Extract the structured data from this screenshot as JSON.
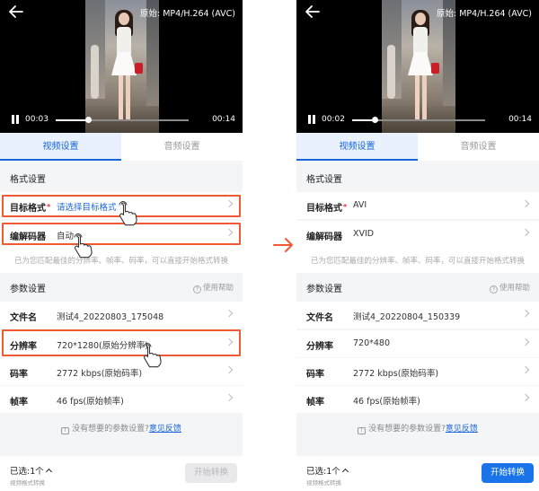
{
  "before": {
    "video": {
      "source_label": "原始: MP4/H.264 (AVC)",
      "current_time": "00:03",
      "total_time": "00:14",
      "progress": 0.24
    },
    "tabs": [
      {
        "label": "视频设置",
        "active": true
      },
      {
        "label": "音频设置",
        "active": false
      }
    ],
    "format_section": {
      "title": "格式设置"
    },
    "target_format": {
      "label": "目标格式",
      "required_mark": "*",
      "value": "请选择目标格式"
    },
    "codec": {
      "label": "编解码器",
      "value": "自动"
    },
    "hint": "已为您匹配最佳的分辨率、帧率、码率，可以直接开始格式转换",
    "param_section": {
      "title": "参数设置",
      "help": "使用帮助"
    },
    "filename": {
      "label": "文件名",
      "value": "测试4_20220803_175048"
    },
    "resolution": {
      "label": "分辨率",
      "value": "720*1280(原始分辨率)"
    },
    "bitrate": {
      "label": "码率",
      "value": "2772 kbps(原始码率)"
    },
    "framerate": {
      "label": "帧率",
      "value": "46 fps(原始帧率)"
    },
    "feedback": {
      "text": "没有想要的参数设置?",
      "link": "意见反馈"
    },
    "bottom": {
      "selected": "已选:1个",
      "subtitle": "视频格式转换",
      "button": "开始转换",
      "button_enabled": false
    }
  },
  "after": {
    "video": {
      "source_label": "原始: MP4/H.264 (AVC)",
      "current_time": "00:02",
      "total_time": "00:14",
      "progress": 0.17
    },
    "tabs": [
      {
        "label": "视频设置",
        "active": true
      },
      {
        "label": "音频设置",
        "active": false
      }
    ],
    "format_section": {
      "title": "格式设置"
    },
    "target_format": {
      "label": "目标格式",
      "required_mark": "*",
      "value": "AVI"
    },
    "codec": {
      "label": "编解码器",
      "value": "XVID"
    },
    "hint": "已为您匹配最佳的分辨率、帧率、码率，可以直接开始格式转换",
    "param_section": {
      "title": "参数设置",
      "help": "使用帮助"
    },
    "filename": {
      "label": "文件名",
      "value": "测试4_20220804_150339"
    },
    "resolution": {
      "label": "分辨率",
      "value": "720*480"
    },
    "bitrate": {
      "label": "码率",
      "value": "2772 kbps(原始码率)"
    },
    "framerate": {
      "label": "帧率",
      "value": "46 fps(原始帧率)"
    },
    "feedback": {
      "text": "没有想要的参数设置?",
      "link": "意见反馈"
    },
    "bottom": {
      "selected": "已选:1个",
      "subtitle": "视频格式转换",
      "button": "开始转换",
      "button_enabled": true
    }
  },
  "colors": {
    "accent": "#1a66d9",
    "highlight": "#f05a32",
    "button": "#1a73e8"
  }
}
